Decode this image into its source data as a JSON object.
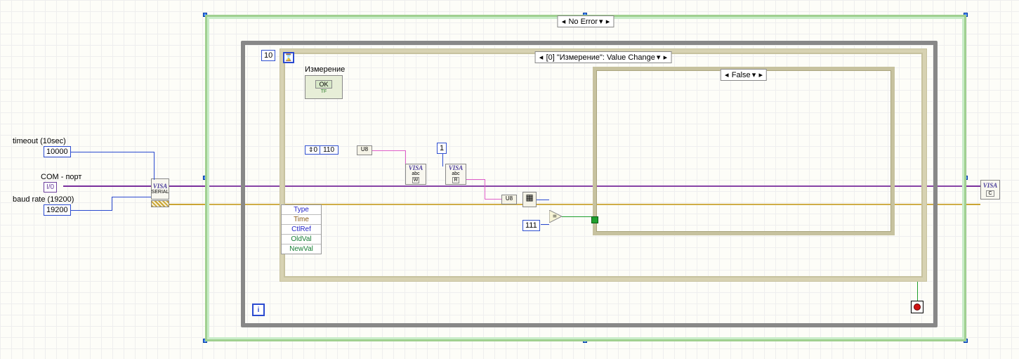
{
  "controls": {
    "timeout": {
      "label": "timeout (10sec)",
      "value": "10000"
    },
    "com_port": {
      "label": "COM - порт",
      "value": "I/0"
    },
    "baud": {
      "label": "baud rate (19200)",
      "value": "19200"
    }
  },
  "visa": {
    "serial": {
      "line1": "VISA",
      "line2": "SERIAL"
    },
    "write": {
      "line1": "VISA",
      "line2": "abc",
      "glyph": "W"
    },
    "read": {
      "line1": "VISA",
      "line2": "abc",
      "glyph": "R"
    },
    "close": {
      "line1": "VISA",
      "glyph": "C"
    }
  },
  "case_outer": {
    "label": "No Error",
    "dd": "▾"
  },
  "event": {
    "label": "[0] \"Измерение\": Value Change",
    "dd": "▾"
  },
  "case_inner": {
    "label": "False",
    "dd": "▾"
  },
  "terminals": [
    "Type",
    "Time",
    "CtlRef",
    "OldVal",
    "NewVal"
  ],
  "button": {
    "caption": "Измерение",
    "text": "OK",
    "tf": "TF"
  },
  "while": {
    "iter_label": "i"
  },
  "constants": {
    "ten": "10",
    "cmd_index": "0",
    "cmd_value": "110",
    "one": "1",
    "expected": "111"
  },
  "nodes": {
    "u8_cast": "U8",
    "u8_cast2": "U8",
    "build_array": "▦",
    "equal": "="
  }
}
